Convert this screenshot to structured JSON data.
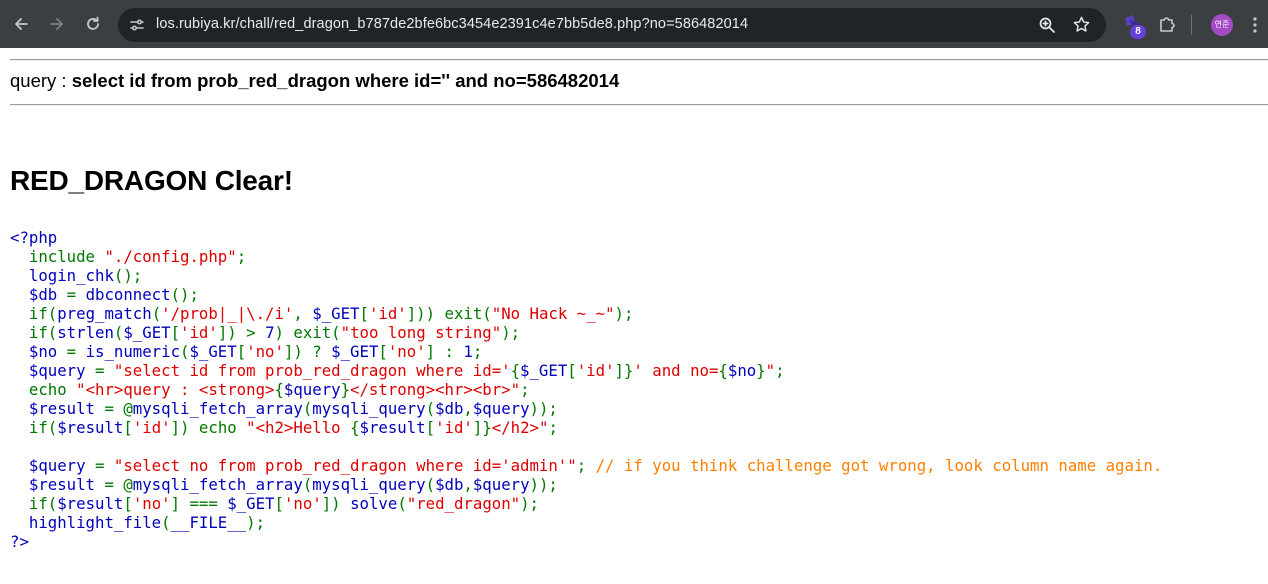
{
  "browser": {
    "url": "los.rubiya.kr/chall/red_dragon_b787de2bfe6bc3454e2391c4e7bb5de8.php?no=586482014",
    "extension_badge": "8",
    "profile_label": "연준"
  },
  "page": {
    "query_label": "query : ",
    "query_text": "select id from prob_red_dragon where id='' and no=586482014",
    "clear_heading": "RED_DRAGON Clear!"
  },
  "source_code": [
    [
      [
        "k",
        "<?php"
      ]
    ],
    [
      [
        "g",
        "  include "
      ],
      [
        "s",
        "\"./config.php\""
      ],
      [
        "g",
        ";"
      ]
    ],
    [
      [
        "g",
        "  "
      ],
      [
        "k",
        "login_chk"
      ],
      [
        "g",
        "();"
      ]
    ],
    [
      [
        "g",
        "  "
      ],
      [
        "k",
        "$db "
      ],
      [
        "g",
        "= "
      ],
      [
        "k",
        "dbconnect"
      ],
      [
        "g",
        "();"
      ]
    ],
    [
      [
        "g",
        "  if("
      ],
      [
        "k",
        "preg_match"
      ],
      [
        "g",
        "("
      ],
      [
        "s",
        "'/prob|_|\\./i'"
      ],
      [
        "g",
        ", "
      ],
      [
        "k",
        "$_GET"
      ],
      [
        "g",
        "["
      ],
      [
        "s",
        "'id'"
      ],
      [
        "g",
        "])) exit("
      ],
      [
        "s",
        "\"No Hack ~_~\""
      ],
      [
        "g",
        ");"
      ]
    ],
    [
      [
        "g",
        "  if("
      ],
      [
        "k",
        "strlen"
      ],
      [
        "g",
        "("
      ],
      [
        "k",
        "$_GET"
      ],
      [
        "g",
        "["
      ],
      [
        "s",
        "'id'"
      ],
      [
        "g",
        "]) > "
      ],
      [
        "k",
        "7"
      ],
      [
        "g",
        ") exit("
      ],
      [
        "s",
        "\"too long string\""
      ],
      [
        "g",
        ");"
      ]
    ],
    [
      [
        "g",
        "  "
      ],
      [
        "k",
        "$no "
      ],
      [
        "g",
        "= "
      ],
      [
        "k",
        "is_numeric"
      ],
      [
        "g",
        "("
      ],
      [
        "k",
        "$_GET"
      ],
      [
        "g",
        "["
      ],
      [
        "s",
        "'no'"
      ],
      [
        "g",
        "]) ? "
      ],
      [
        "k",
        "$_GET"
      ],
      [
        "g",
        "["
      ],
      [
        "s",
        "'no'"
      ],
      [
        "g",
        "] : "
      ],
      [
        "k",
        "1"
      ],
      [
        "g",
        ";"
      ]
    ],
    [
      [
        "g",
        "  "
      ],
      [
        "k",
        "$query "
      ],
      [
        "g",
        "= "
      ],
      [
        "s",
        "\"select id from prob_red_dragon where id='"
      ],
      [
        "g",
        "{"
      ],
      [
        "k",
        "$_GET"
      ],
      [
        "g",
        "["
      ],
      [
        "s",
        "'id'"
      ],
      [
        "g",
        "]}"
      ],
      [
        "s",
        "' and no="
      ],
      [
        "g",
        "{"
      ],
      [
        "k",
        "$no"
      ],
      [
        "g",
        "}"
      ],
      [
        "s",
        "\""
      ],
      [
        "g",
        ";"
      ]
    ],
    [
      [
        "g",
        "  echo "
      ],
      [
        "s",
        "\"<hr>query : <strong>"
      ],
      [
        "g",
        "{"
      ],
      [
        "k",
        "$query"
      ],
      [
        "g",
        "}"
      ],
      [
        "s",
        "</strong><hr><br>\""
      ],
      [
        "g",
        ";"
      ]
    ],
    [
      [
        "g",
        "  "
      ],
      [
        "k",
        "$result "
      ],
      [
        "g",
        "= @"
      ],
      [
        "k",
        "mysqli_fetch_array"
      ],
      [
        "g",
        "("
      ],
      [
        "k",
        "mysqli_query"
      ],
      [
        "g",
        "("
      ],
      [
        "k",
        "$db"
      ],
      [
        "g",
        ","
      ],
      [
        "k",
        "$query"
      ],
      [
        "g",
        "));"
      ]
    ],
    [
      [
        "g",
        "  if("
      ],
      [
        "k",
        "$result"
      ],
      [
        "g",
        "["
      ],
      [
        "s",
        "'id'"
      ],
      [
        "g",
        "]) echo "
      ],
      [
        "s",
        "\"<h2>Hello "
      ],
      [
        "g",
        "{"
      ],
      [
        "k",
        "$result"
      ],
      [
        "g",
        "["
      ],
      [
        "s",
        "'id'"
      ],
      [
        "g",
        "]}"
      ],
      [
        "s",
        "</h2>\""
      ],
      [
        "g",
        ";"
      ]
    ],
    [
      [
        "g",
        ""
      ]
    ],
    [
      [
        "g",
        "  "
      ],
      [
        "k",
        "$query "
      ],
      [
        "g",
        "= "
      ],
      [
        "s",
        "\"select no from prob_red_dragon where id='admin'\""
      ],
      [
        "g",
        "; "
      ],
      [
        "c",
        "// if you think challenge got wrong, look column name again."
      ]
    ],
    [
      [
        "g",
        "  "
      ],
      [
        "k",
        "$result "
      ],
      [
        "g",
        "= @"
      ],
      [
        "k",
        "mysqli_fetch_array"
      ],
      [
        "g",
        "("
      ],
      [
        "k",
        "mysqli_query"
      ],
      [
        "g",
        "("
      ],
      [
        "k",
        "$db"
      ],
      [
        "g",
        ","
      ],
      [
        "k",
        "$query"
      ],
      [
        "g",
        "));"
      ]
    ],
    [
      [
        "g",
        "  if("
      ],
      [
        "k",
        "$result"
      ],
      [
        "g",
        "["
      ],
      [
        "s",
        "'no'"
      ],
      [
        "g",
        "] === "
      ],
      [
        "k",
        "$_GET"
      ],
      [
        "g",
        "["
      ],
      [
        "s",
        "'no'"
      ],
      [
        "g",
        "]) "
      ],
      [
        "k",
        "solve"
      ],
      [
        "g",
        "("
      ],
      [
        "s",
        "\"red_dragon\""
      ],
      [
        "g",
        ");"
      ]
    ],
    [
      [
        "g",
        "  "
      ],
      [
        "k",
        "highlight_file"
      ],
      [
        "g",
        "("
      ],
      [
        "k",
        "__FILE__"
      ],
      [
        "g",
        ");"
      ]
    ],
    [
      [
        "k",
        "?>"
      ]
    ]
  ]
}
